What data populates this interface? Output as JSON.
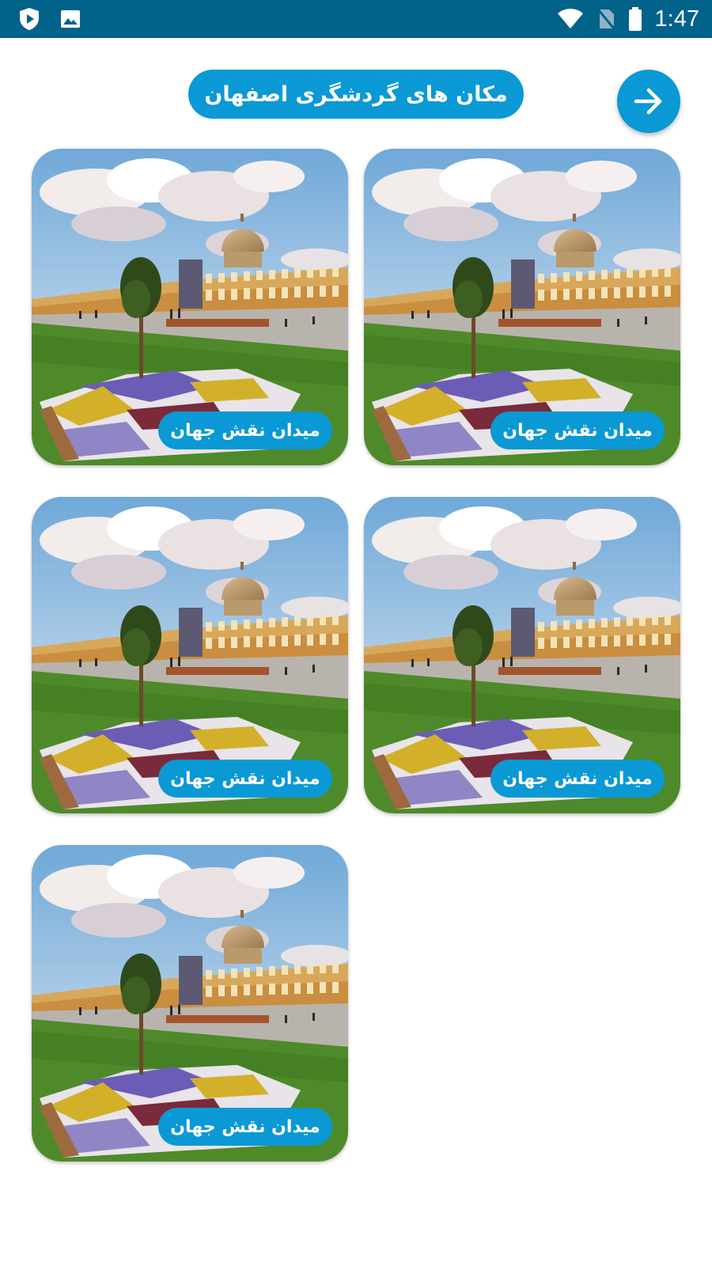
{
  "status_bar": {
    "time": "1:47",
    "left_icons": [
      "play-protect-icon",
      "image-icon"
    ],
    "right_icons": [
      "wifi-icon",
      "no-sim-icon",
      "battery-icon"
    ]
  },
  "header": {
    "title": "مکان های گردشگری اصفهان",
    "forward_button_icon": "arrow-right-icon"
  },
  "places": [
    {
      "label": "میدان نقش جهان"
    },
    {
      "label": "میدان نقش جهان"
    },
    {
      "label": "میدان نقش جهان"
    },
    {
      "label": "میدان نقش جهان"
    },
    {
      "label": "میدان نقش جهان"
    }
  ],
  "colors": {
    "status_bar": "#01628a",
    "accent": "#0a99d4",
    "background": "#ffffff"
  }
}
